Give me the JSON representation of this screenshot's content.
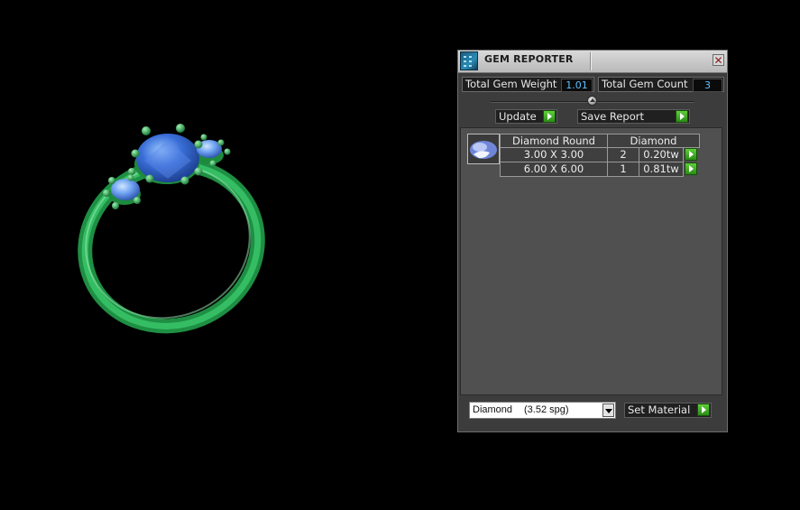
{
  "viewport": {
    "ring_color": "#2fb85a",
    "gem_color": "#3b6fd8"
  },
  "panel": {
    "title": "GEM REPORTER",
    "close_glyph": "✕",
    "total_weight_label": "Total Gem Weight",
    "total_weight_value": "1.01",
    "total_count_label": "Total Gem Count",
    "total_count_value": "3",
    "update_label": "Update",
    "save_report_label": "Save Report",
    "table": {
      "header_shape": "Diamond Round",
      "header_material": "Diamond",
      "rows": [
        {
          "size": "3.00 X 3.00",
          "count": "2",
          "weight": "0.20tw"
        },
        {
          "size": "6.00 X 6.00",
          "count": "1",
          "weight": "0.81tw"
        }
      ]
    },
    "material_select": {
      "name": "Diamond",
      "spg": "(3.52 spg)"
    },
    "set_material_label": "Set Material",
    "accent_color": "#3fae22"
  }
}
